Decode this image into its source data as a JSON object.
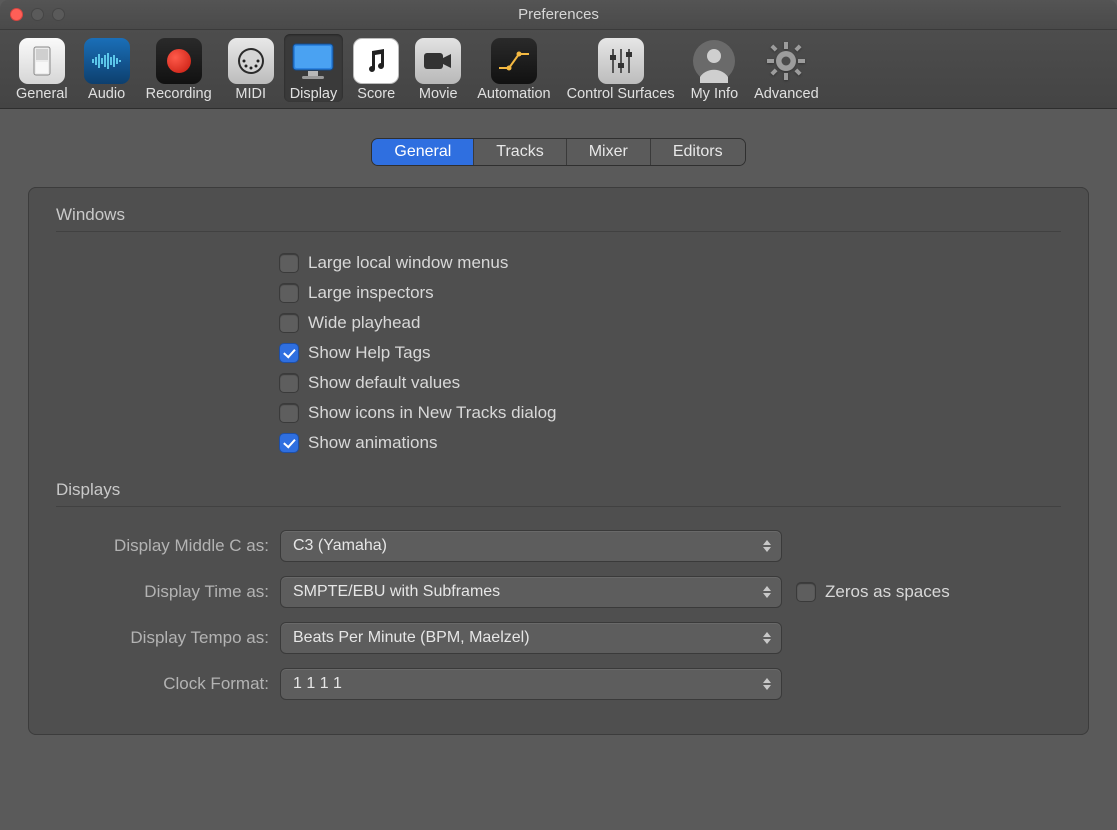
{
  "window": {
    "title": "Preferences"
  },
  "toolbar": {
    "items": {
      "general": {
        "label": "General"
      },
      "audio": {
        "label": "Audio"
      },
      "recording": {
        "label": "Recording"
      },
      "midi": {
        "label": "MIDI"
      },
      "display": {
        "label": "Display"
      },
      "score": {
        "label": "Score"
      },
      "movie": {
        "label": "Movie"
      },
      "automation": {
        "label": "Automation"
      },
      "ctrl": {
        "label": "Control Surfaces"
      },
      "myinfo": {
        "label": "My Info"
      },
      "advanced": {
        "label": "Advanced"
      }
    },
    "selected": "display"
  },
  "subtabs": {
    "general": "General",
    "tracks": "Tracks",
    "mixer": "Mixer",
    "editors": "Editors",
    "active": "general"
  },
  "sections": {
    "windows": {
      "title": "Windows"
    },
    "displays": {
      "title": "Displays"
    }
  },
  "checkboxes": {
    "large_menus": {
      "label": "Large local window menus",
      "checked": false
    },
    "large_insp": {
      "label": "Large inspectors",
      "checked": false
    },
    "wide_playhead": {
      "label": "Wide playhead",
      "checked": false
    },
    "help_tags": {
      "label": "Show Help Tags",
      "checked": true
    },
    "default_vals": {
      "label": "Show default values",
      "checked": false
    },
    "icons_newtrk": {
      "label": "Show icons in New Tracks dialog",
      "checked": false
    },
    "animations": {
      "label": "Show animations",
      "checked": true
    }
  },
  "form": {
    "middle_c": {
      "label": "Display Middle C as:",
      "value": "C3 (Yamaha)"
    },
    "time": {
      "label": "Display Time as:",
      "value": "SMPTE/EBU with Subframes"
    },
    "zeros": {
      "label": "Zeros as spaces",
      "checked": false
    },
    "tempo": {
      "label": "Display Tempo as:",
      "value": "Beats Per Minute (BPM, Maelzel)"
    },
    "clock": {
      "label": "Clock Format:",
      "value": "1 1 1 1"
    }
  }
}
